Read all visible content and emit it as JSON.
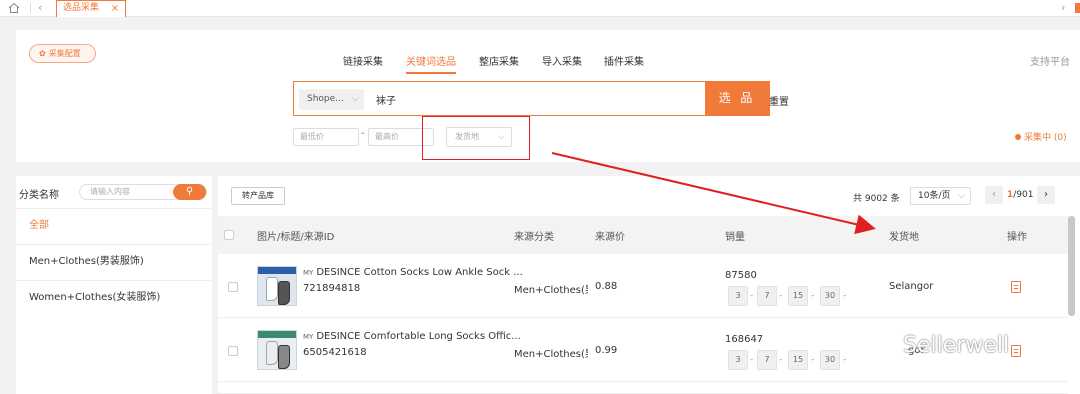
{
  "tabs": {
    "active_label": "选品采集",
    "close": "×"
  },
  "config_button": "采集配置",
  "modes": [
    "链接采集",
    "关键词选品",
    "整店采集",
    "导入采集",
    "插件采集"
  ],
  "active_mode": "关键词选品",
  "support_label": "支持平台",
  "search": {
    "platform": "Shope...",
    "keyword": "袜子",
    "submit": "选 品",
    "reset": "重置"
  },
  "filters": {
    "min_price_placeholder": "最低价",
    "max_price_placeholder": "最高价",
    "range_sep": "-",
    "ship_from_placeholder": "发货地"
  },
  "collecting_status": "采集中 (0)",
  "categories": {
    "title": "分类名称",
    "search_placeholder": "请输入内容",
    "items": [
      "全部",
      "Men+Clothes(男装服饰)",
      "Women+Clothes(女装服饰)"
    ]
  },
  "toolbar": {
    "store_button": "转产品库"
  },
  "pagination": {
    "total": "共 9002 条",
    "per_page": "10条/页",
    "current": "1",
    "pages": "/901"
  },
  "table": {
    "headers": [
      "图片/标题/来源ID",
      "来源分类",
      "来源价",
      "销量",
      "发货地",
      "操作"
    ],
    "rows": [
      {
        "tag": "MY",
        "title": "DESINCE Cotton Socks Low Ankle Sock ...",
        "id": "721894818",
        "category": "Men+Clothes(男装",
        "price": "0.88",
        "sales": "87580",
        "chips": [
          "3",
          "7",
          "15",
          "30"
        ],
        "ship_from": "Selangor"
      },
      {
        "tag": "MY",
        "title": "DESINCE Comfortable Long Socks Offic...",
        "id": "6505421618",
        "category": "Men+Clothes(男装",
        "price": "0.99",
        "sales": "168647",
        "chips": [
          "3",
          "7",
          "15",
          "30"
        ],
        "ship_from": "gor"
      }
    ]
  },
  "watermark": "Sellerwell",
  "colors": {
    "accent": "#f07a3a",
    "annotation": "#e02020"
  }
}
